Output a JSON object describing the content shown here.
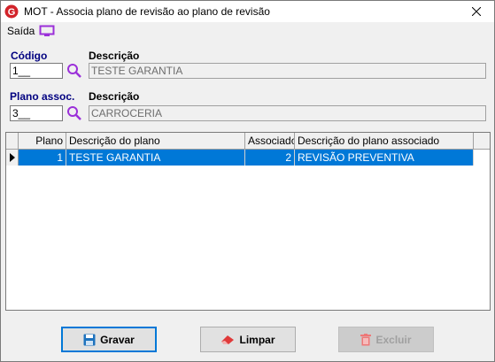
{
  "window": {
    "title": "MOT - Associa plano de revisão ao plano de revisão"
  },
  "menu": {
    "saida_label": "Saída"
  },
  "form": {
    "codigo_label": "Código",
    "codigo_value": "1__",
    "descricao1_label": "Descrição",
    "descricao1_value": "TESTE GARANTIA",
    "plano_assoc_label": "Plano assoc.",
    "plano_assoc_value": "3__",
    "descricao2_label": "Descrição",
    "descricao2_value": "CARROCERIA"
  },
  "grid": {
    "columns": [
      "Plano",
      "Descrição do plano",
      "Associado",
      "Descrição do plano associado"
    ],
    "rows": [
      {
        "plano": "1",
        "descricao": "TESTE GARANTIA",
        "associado": "2",
        "descricao_assoc": "REVISÃO PREVENTIVA"
      }
    ]
  },
  "buttons": {
    "gravar_label": "Gravar",
    "limpar_label": "Limpar",
    "excluir_label": "Excluir"
  },
  "colors": {
    "selection": "#0078d7",
    "label_blue": "#000080",
    "icon_purple": "#9b30d9"
  }
}
